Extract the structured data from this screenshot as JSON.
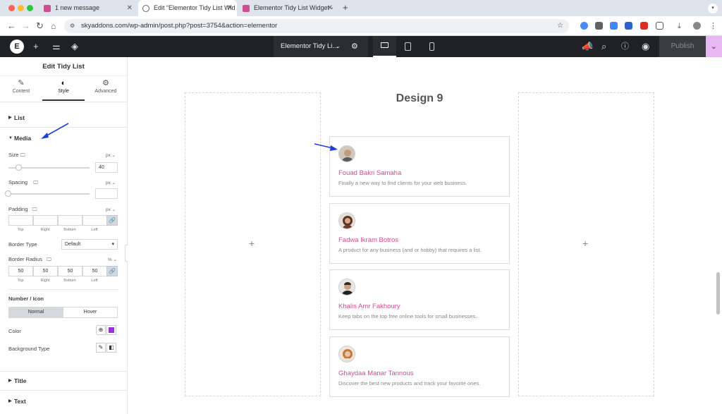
{
  "browser": {
    "tabs": [
      {
        "title": "1 new message",
        "favicon_color": "#d04d8f"
      },
      {
        "title": "Edit “Elementor Tidy List Wid",
        "favicon_color": "#5f6368"
      },
      {
        "title": "Elementor Tidy List Widget -",
        "favicon_color": "#d04d8f"
      }
    ],
    "new_tab": "+",
    "url": "skyaddons.com/wp-admin/post.php?post=3754&action=elementor"
  },
  "editor": {
    "logo": "E",
    "document_name": "Elementor Tidy Li...",
    "publish_label": "Publish"
  },
  "sidebar": {
    "title": "Edit Tidy List",
    "tabs": [
      {
        "label": "Content",
        "icon": "pencil-icon"
      },
      {
        "label": "Style",
        "icon": "half-circle-icon"
      },
      {
        "label": "Advanced",
        "icon": "gear-icon"
      }
    ],
    "sections": {
      "list": "List",
      "media": "Media",
      "title": "Title",
      "text": "Text"
    },
    "media": {
      "size_label": "Size",
      "size_unit": "px",
      "size_value": "40",
      "spacing_label": "Spacing",
      "spacing_unit": "px",
      "padding_label": "Padding",
      "padding_unit": "px",
      "dim_labels": [
        "Top",
        "Right",
        "Bottom",
        "Left"
      ],
      "border_type_label": "Border Type",
      "border_type_value": "Default",
      "border_radius_label": "Border Radius",
      "border_radius_unit": "%",
      "border_radius_values": [
        "50",
        "50",
        "50",
        "50"
      ],
      "number_icon_label": "Number / Icon",
      "normal_label": "Normal",
      "hover_label": "Hover",
      "color_label": "Color",
      "color_swatch": "#9b30d9",
      "background_type_label": "Background Type"
    }
  },
  "canvas": {
    "heading": "Design 9",
    "items": [
      {
        "name": "Fouad Bakri Samaha",
        "desc": "Finally a new way to find clients for your web business."
      },
      {
        "name": "Fadwa Ikram Botros",
        "desc": "A product for any business (and or hobby) that requires a list."
      },
      {
        "name": "Khalis Amr Fakhoury",
        "desc": "Keep tabs on the top free online tools for small businesses."
      },
      {
        "name": "Ghaydaa Manar Tannous",
        "desc": "Discover the best new products and track your favorite ones."
      }
    ],
    "accent": "#d04d8f"
  }
}
